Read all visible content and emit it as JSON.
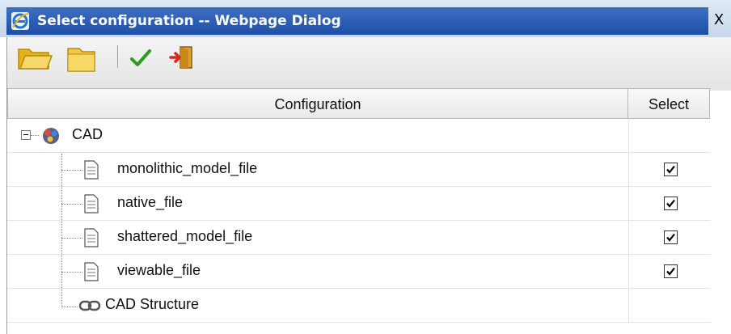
{
  "window": {
    "title": "Select configuration -- Webpage Dialog",
    "close_glyph": "X"
  },
  "toolbar": {
    "buttons": [
      {
        "icon": "open-folder-icon"
      },
      {
        "icon": "folder-icon"
      },
      {
        "icon": "checkmark-icon"
      },
      {
        "icon": "exit-door-icon"
      }
    ]
  },
  "table": {
    "columns": {
      "configuration": "Configuration",
      "select": "Select"
    },
    "root": {
      "label": "CAD",
      "expanded": true,
      "icon": "cad-assembly-icon"
    },
    "children": [
      {
        "label": "monolithic_model_file",
        "icon": "document-icon",
        "selected": true
      },
      {
        "label": "native_file",
        "icon": "document-icon",
        "selected": true
      },
      {
        "label": "shattered_model_file",
        "icon": "document-icon",
        "selected": true
      },
      {
        "label": "viewable_file",
        "icon": "document-icon",
        "selected": true
      },
      {
        "label": "CAD Structure",
        "icon": "chain-link-icon",
        "selected": null
      }
    ]
  },
  "colors": {
    "title_bar": "#2a5bb3",
    "check_green": "#2f9a1f",
    "folder_yellow": "#f2c744"
  }
}
